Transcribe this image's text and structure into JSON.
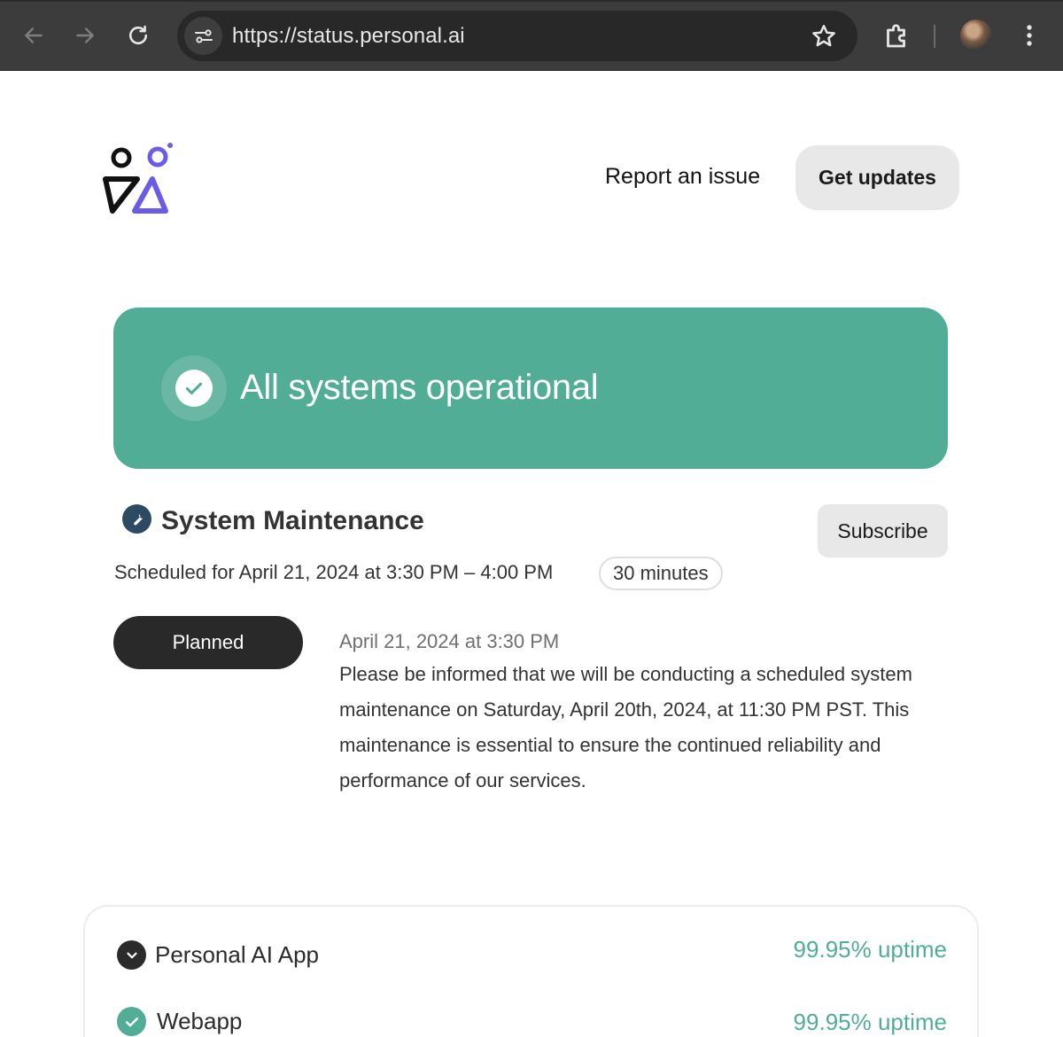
{
  "browser": {
    "url": "https://status.personal.ai",
    "icons": [
      "back-arrow-icon",
      "forward-arrow-icon",
      "reload-icon",
      "site-info-icon",
      "bookmark-star-icon",
      "extensions-icon",
      "profile-avatar",
      "menu-kebab-icon"
    ]
  },
  "header": {
    "logo": "personal-ai-logo",
    "report_label": "Report an issue",
    "updates_label": "Get updates"
  },
  "status": {
    "title": "All systems operational",
    "color": "#52ad96"
  },
  "maintenance": {
    "title": "System Maintenance",
    "subscribe_label": "Subscribe",
    "schedule": "Scheduled for April 21, 2024 at 3:30 PM – 4:00 PM",
    "duration": "30 minutes",
    "state": "Planned",
    "update": {
      "time": "April 21, 2024 at 3:30 PM",
      "body": "Please be informed that we will be conducting a scheduled system maintenance on Saturday, April 20th, 2024, at 11:30 PM PST. This maintenance is essential to ensure the continued reliability and performance of our services."
    }
  },
  "components": [
    {
      "name": "Personal AI App",
      "uptime": "99.95% uptime",
      "icon": "chevron-down-icon"
    },
    {
      "name": "Webapp",
      "uptime": "99.95% uptime",
      "icon": "check-circle-icon"
    }
  ],
  "colors": {
    "accent": "#52ad96",
    "logo_dark": "#111111",
    "logo_purple": "#6b5ce7"
  }
}
